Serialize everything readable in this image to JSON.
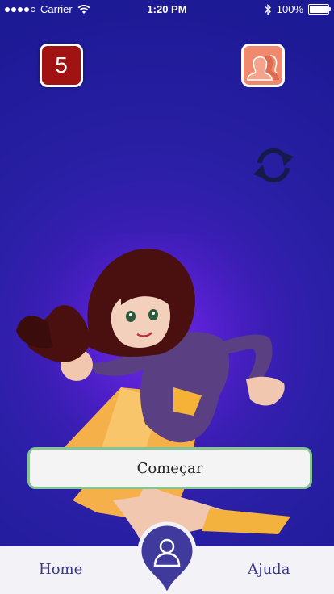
{
  "status_bar": {
    "carrier": "Carrier",
    "time": "1:20 PM",
    "battery": "100%"
  },
  "header": {
    "lives_count": "5",
    "friends_icon": "friends-icon",
    "refresh_icon": "refresh-icon"
  },
  "main": {
    "start_label": "Começar"
  },
  "bottom_nav": {
    "home_label": "Home",
    "help_label": "Ajuda",
    "profile_icon": "profile-pin-icon"
  },
  "colors": {
    "background": "#2a1fa6",
    "lives_badge": "#a11313",
    "friends_badge": "#f08a6e",
    "start_border": "#84c392",
    "nav_text": "#3a3590"
  }
}
